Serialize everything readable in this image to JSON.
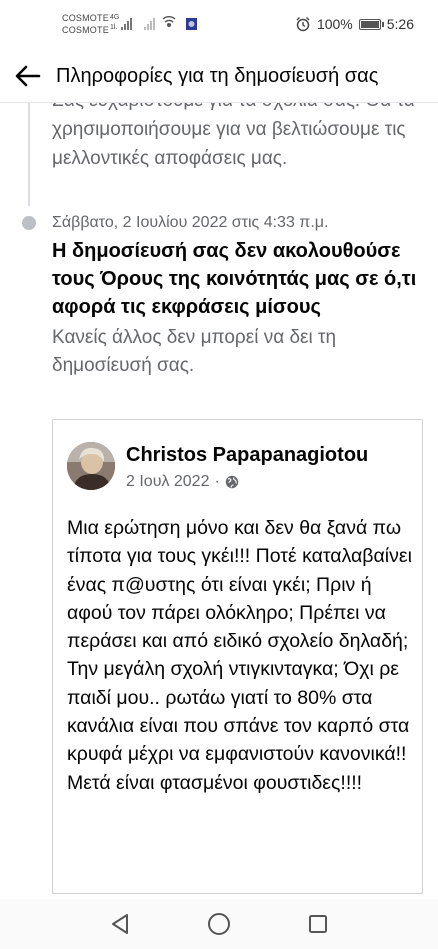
{
  "status_bar": {
    "carrier_1": "COSMOTE",
    "carrier_2": "COSMOTE",
    "network_1": "4G",
    "network_2": "1l.",
    "battery_percent": "100%",
    "battery_level": 1.0,
    "time": "5:26"
  },
  "header": {
    "title": "Πληροφορίες για τη δημοσίευσή σας"
  },
  "previous_entry": {
    "text": "Σας ευχαριστούμε για τα σχόλιά σας. Θα τα χρησιμοποιήσουμε για να βελτιώσουμε τις μελλοντικές αποφάσεις μας."
  },
  "entry": {
    "date": "Σάββατο, 2 Ιουλίου 2022 στις 4:33 π.μ.",
    "title": "Η δημοσίευσή σας δεν ακολουθούσε τους Όρους της κοινότητάς μας σε ό,τι αφορά τις εκφράσεις μίσους",
    "description": "Κανείς άλλος δεν μπορεί να δει τη δημοσίευσή σας."
  },
  "post": {
    "author": "Christos Papapanagiotou",
    "date": "2 Ιουλ 2022",
    "separator": "·",
    "privacy_icon": "globe-icon",
    "text": "Μια ερώτηση μόνο και δεν θα ξανά πω τίποτα για τους γκέι!!! Ποτέ καταλαβαίνει ένας π@υστης ότι είναι γκέι; Πριν ή αφού τον πάρει ολόκληρο; Πρέπει να περάσει και από ειδικό σχολείο δηλαδή; Την μεγάλη σχολή ντιγκινταγκα; Όχι ρε παιδί μου.. ρωτάω γιατί το 80% στα κανάλια είναι που σπάνε τον καρπό στα κρυφά μέχρι να εμφανιστούν κανονικά!! Μετά είναι φτασμένοι φουστιδες!!!!"
  },
  "nav": {
    "back_icon": "triangle-back-icon",
    "home_icon": "circle-home-icon",
    "recents_icon": "square-recents-icon"
  },
  "colors": {
    "primary_text": "#050505",
    "secondary_text": "#65676b",
    "divider": "#dadde1",
    "card_border": "#ced0d4"
  }
}
